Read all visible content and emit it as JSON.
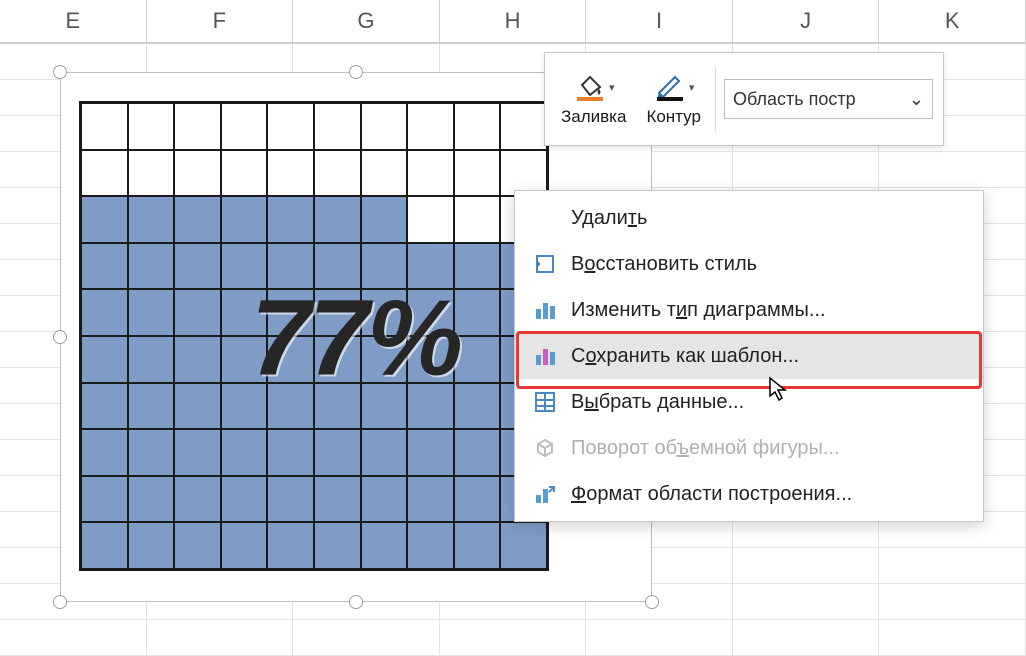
{
  "columns": [
    "E",
    "F",
    "G",
    "H",
    "I",
    "J",
    "K"
  ],
  "chart_data": {
    "type": "waffle",
    "rows": 10,
    "cols": 10,
    "percent": 77,
    "percent_label": "77%",
    "fill_color": "#7f9cc7"
  },
  "toolbar": {
    "fill_label": "Заливка",
    "outline_label": "Контур",
    "area_label": "Область постр"
  },
  "context_menu": {
    "delete": "Удалить",
    "reset_style": "Восстановить стиль",
    "change_type": "Изменить тип диаграммы...",
    "save_template": "Сохранить как шаблон...",
    "select_data": "Выбрать данные...",
    "rotate_3d": "Поворот объемной фигуры...",
    "format_area": "Формат области построения...",
    "hovered_index": 3,
    "disabled": [
      "rotate_3d"
    ]
  }
}
